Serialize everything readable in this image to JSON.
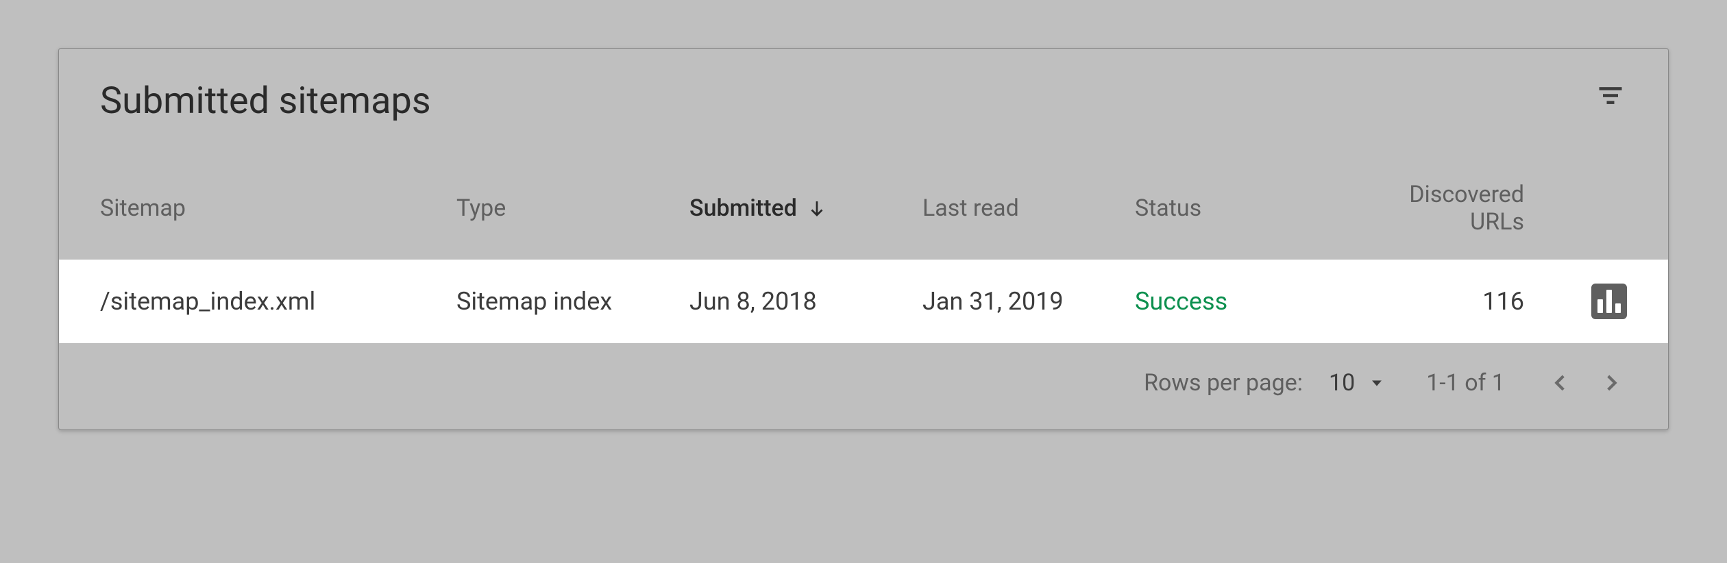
{
  "title": "Submitted sitemaps",
  "columns": {
    "sitemap": "Sitemap",
    "type": "Type",
    "submitted": "Submitted",
    "lastread": "Last read",
    "status": "Status",
    "discovered": "Discovered URLs"
  },
  "rows": [
    {
      "sitemap": "/sitemap_index.xml",
      "type": "Sitemap index",
      "submitted": "Jun 8, 2018",
      "lastread": "Jan 31, 2019",
      "status": "Success",
      "discovered": "116"
    }
  ],
  "pagination": {
    "rows_per_page_label": "Rows per page:",
    "rows_per_page_value": "10",
    "range": "1-1 of 1"
  }
}
